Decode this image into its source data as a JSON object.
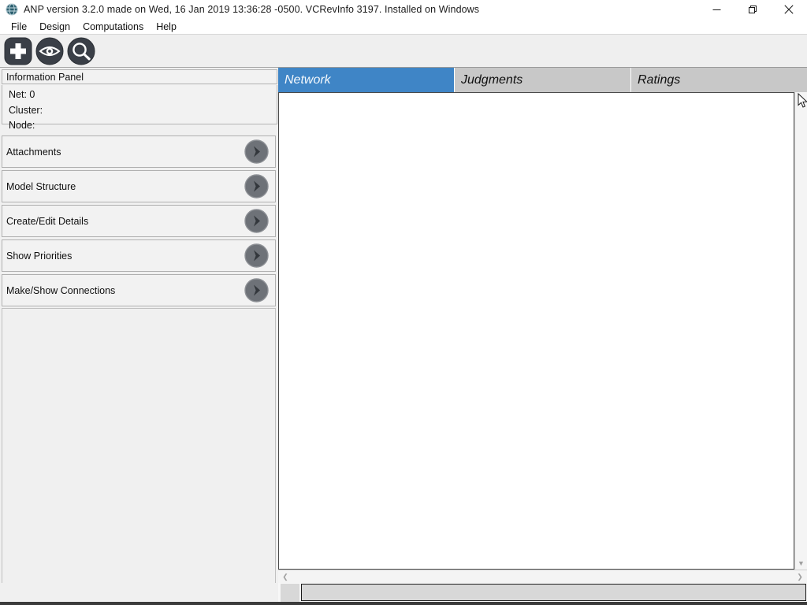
{
  "window": {
    "title": "ANP version 3.2.0 made on Wed, 16 Jan 2019 13:36:28 -0500.  VCRevInfo 3197.  Installed on Windows",
    "app_icon": "globe-icon",
    "controls": {
      "minimize": "—",
      "restore": "restore-icon",
      "close": "×"
    }
  },
  "menubar": {
    "items": [
      {
        "label": "File"
      },
      {
        "label": "Design"
      },
      {
        "label": "Computations"
      },
      {
        "label": "Help"
      }
    ]
  },
  "toolbar": {
    "buttons": [
      {
        "name": "add-node-button",
        "icon": "plus-icon"
      },
      {
        "name": "view-button",
        "icon": "eye-icon"
      },
      {
        "name": "zoom-tools-button",
        "icon": "magnifier-wrench-icon"
      }
    ]
  },
  "information_panel": {
    "header": "Information Panel",
    "fields": [
      {
        "label": "Net: 0"
      },
      {
        "label": "Cluster:"
      },
      {
        "label": "Node:"
      }
    ],
    "accordion": [
      {
        "label": "Attachments",
        "icon": "chevron-right-icon"
      },
      {
        "label": "Model Structure",
        "icon": "chevron-right-icon"
      },
      {
        "label": "Create/Edit Details",
        "icon": "chevron-right-icon"
      },
      {
        "label": "Show Priorities",
        "icon": "chevron-right-icon"
      },
      {
        "label": "Make/Show Connections",
        "icon": "chevron-right-icon"
      }
    ]
  },
  "tabs": {
    "selected": "Network",
    "items": [
      {
        "label": "Network"
      },
      {
        "label": "Judgments"
      },
      {
        "label": "Ratings"
      }
    ]
  },
  "canvas": {
    "content": ""
  },
  "scrollbars": {
    "vertical": {
      "up": "▲",
      "down": "▼"
    },
    "horizontal": {
      "left": "❮",
      "right": "❯"
    }
  },
  "statusbar": {
    "text": ""
  },
  "colors": {
    "selected_tab": "#3f85c6",
    "tab_strip": "#c8c8c8",
    "panel": "#f0f0f0",
    "toolbar_icon": "#3a3f47"
  }
}
